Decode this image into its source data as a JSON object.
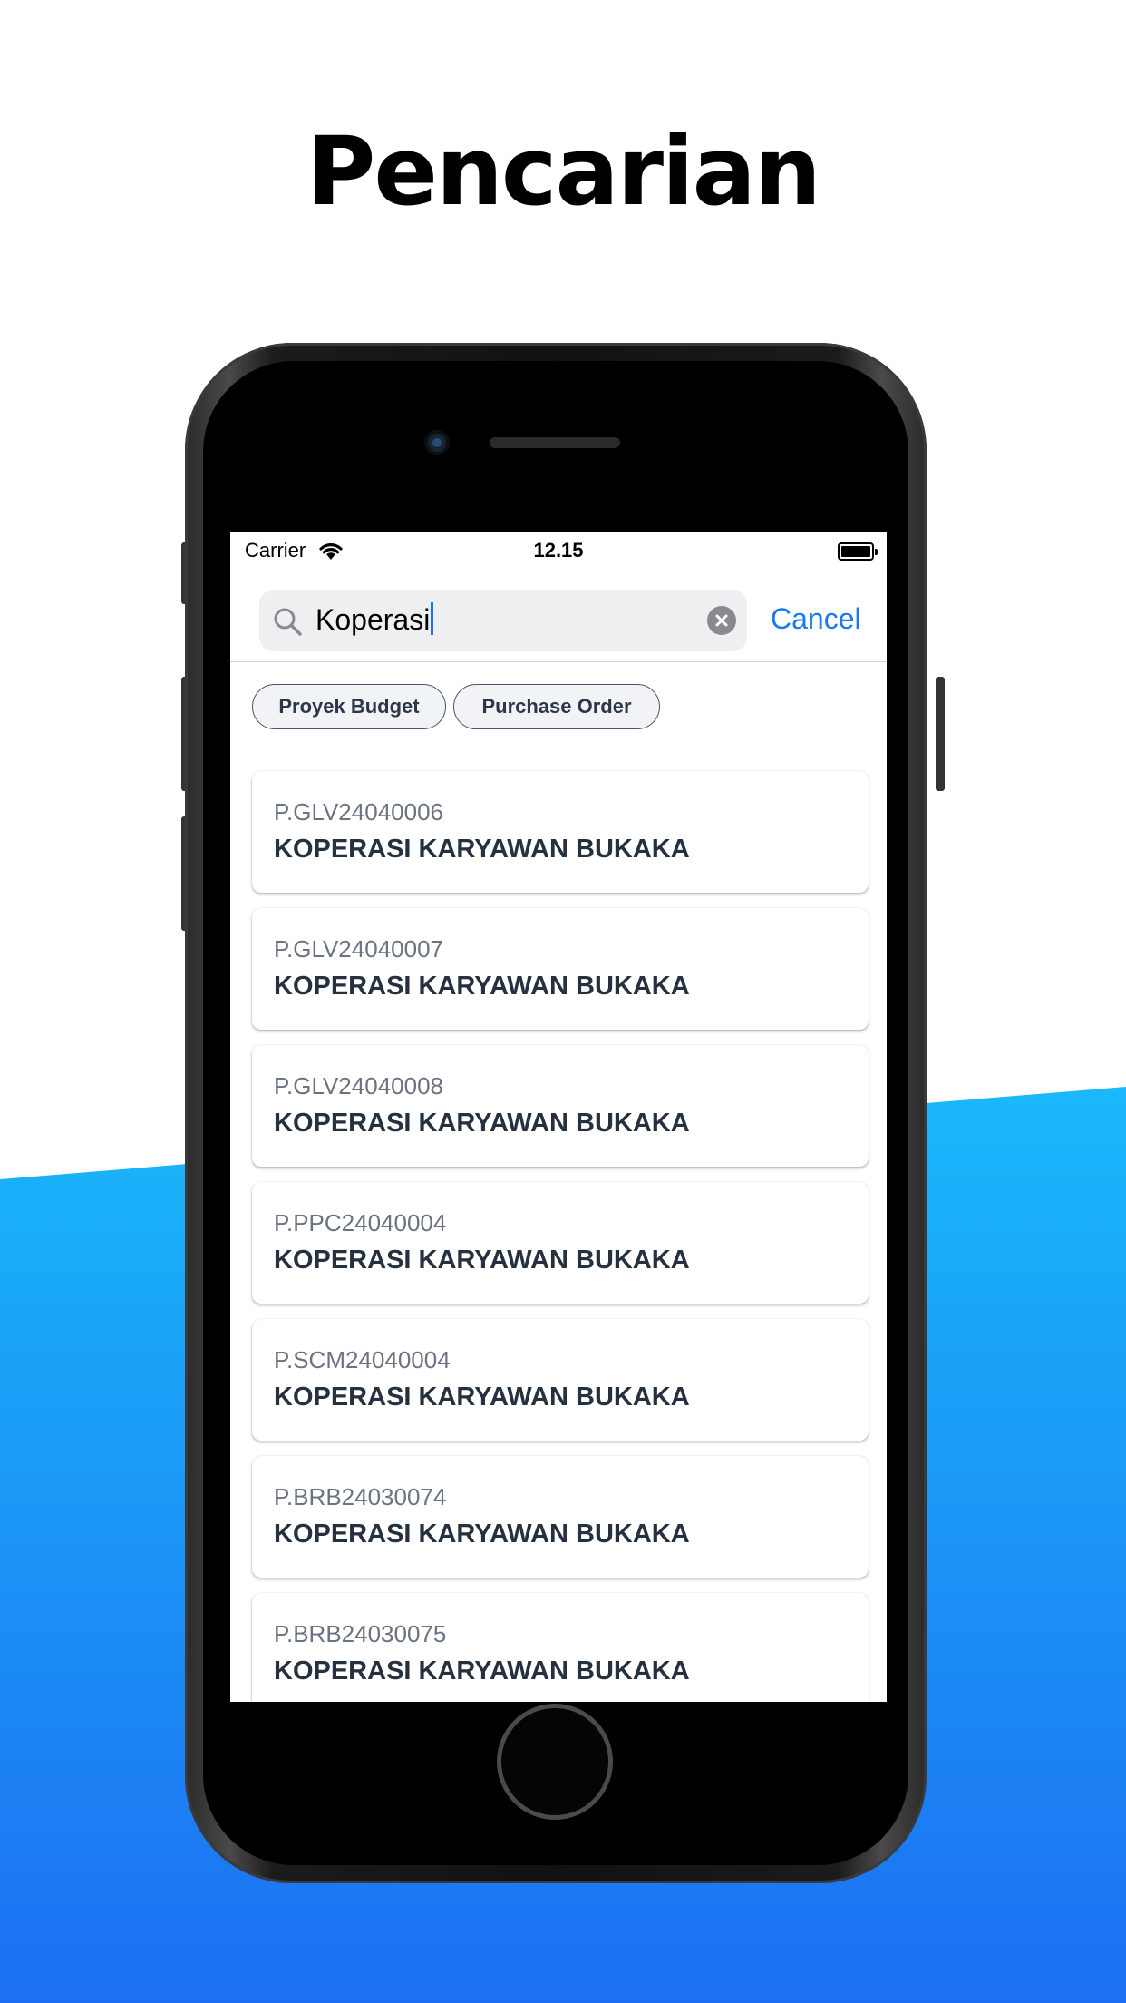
{
  "headline": "Pencarian",
  "colors": {
    "accent": "#1a7af0",
    "wave_top": "#1ab8fa",
    "wave_bottom": "#1c6ff2",
    "chip_border": "#4a5568",
    "card_title": "#26313f"
  },
  "status_bar": {
    "carrier": "Carrier",
    "time": "12.15",
    "wifi_icon": "wifi-icon",
    "battery_icon": "battery-icon"
  },
  "search": {
    "value": "Koperasi",
    "search_icon": "search-icon",
    "clear_icon": "clear-icon",
    "cancel_label": "Cancel"
  },
  "filters": [
    {
      "label": "Proyek Budget"
    },
    {
      "label": "Purchase Order"
    }
  ],
  "results": [
    {
      "code": "P.GLV24040006",
      "name": "KOPERASI KARYAWAN BUKAKA"
    },
    {
      "code": "P.GLV24040007",
      "name": "KOPERASI KARYAWAN BUKAKA"
    },
    {
      "code": "P.GLV24040008",
      "name": "KOPERASI KARYAWAN BUKAKA"
    },
    {
      "code": "P.PPC24040004",
      "name": "KOPERASI KARYAWAN BUKAKA"
    },
    {
      "code": "P.SCM24040004",
      "name": "KOPERASI KARYAWAN BUKAKA"
    },
    {
      "code": "P.BRB24030074",
      "name": "KOPERASI KARYAWAN BUKAKA"
    },
    {
      "code": "P.BRB24030075",
      "name": "KOPERASI KARYAWAN BUKAKA"
    }
  ]
}
